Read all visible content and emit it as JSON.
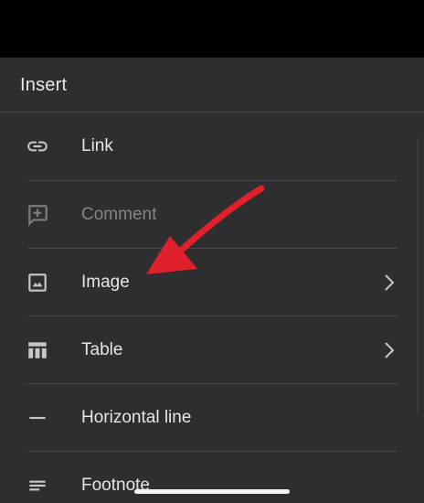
{
  "colors": {
    "sheet_background": "#2e2e30",
    "divider": "#4a4a4d",
    "text_primary": "#e6e6e8",
    "text_disabled": "#85858a",
    "icon_primary": "#c8c8cc",
    "icon_disabled": "#7c7c80",
    "annotation_arrow": "#e0202a"
  },
  "sheet": {
    "title": "Insert"
  },
  "menu": {
    "items": [
      {
        "label": "Link",
        "icon": "link-icon",
        "enabled": true,
        "has_submenu": false
      },
      {
        "label": "Comment",
        "icon": "add-comment-icon",
        "enabled": false,
        "has_submenu": false
      },
      {
        "label": "Image",
        "icon": "image-icon",
        "enabled": true,
        "has_submenu": true
      },
      {
        "label": "Table",
        "icon": "table-icon",
        "enabled": true,
        "has_submenu": true
      },
      {
        "label": "Horizontal line",
        "icon": "horizontal-line-icon",
        "enabled": true,
        "has_submenu": false
      },
      {
        "label": "Footnote",
        "icon": "footnote-icon",
        "enabled": true,
        "has_submenu": false
      }
    ]
  },
  "annotation": {
    "type": "arrow",
    "points_to": "Image"
  }
}
